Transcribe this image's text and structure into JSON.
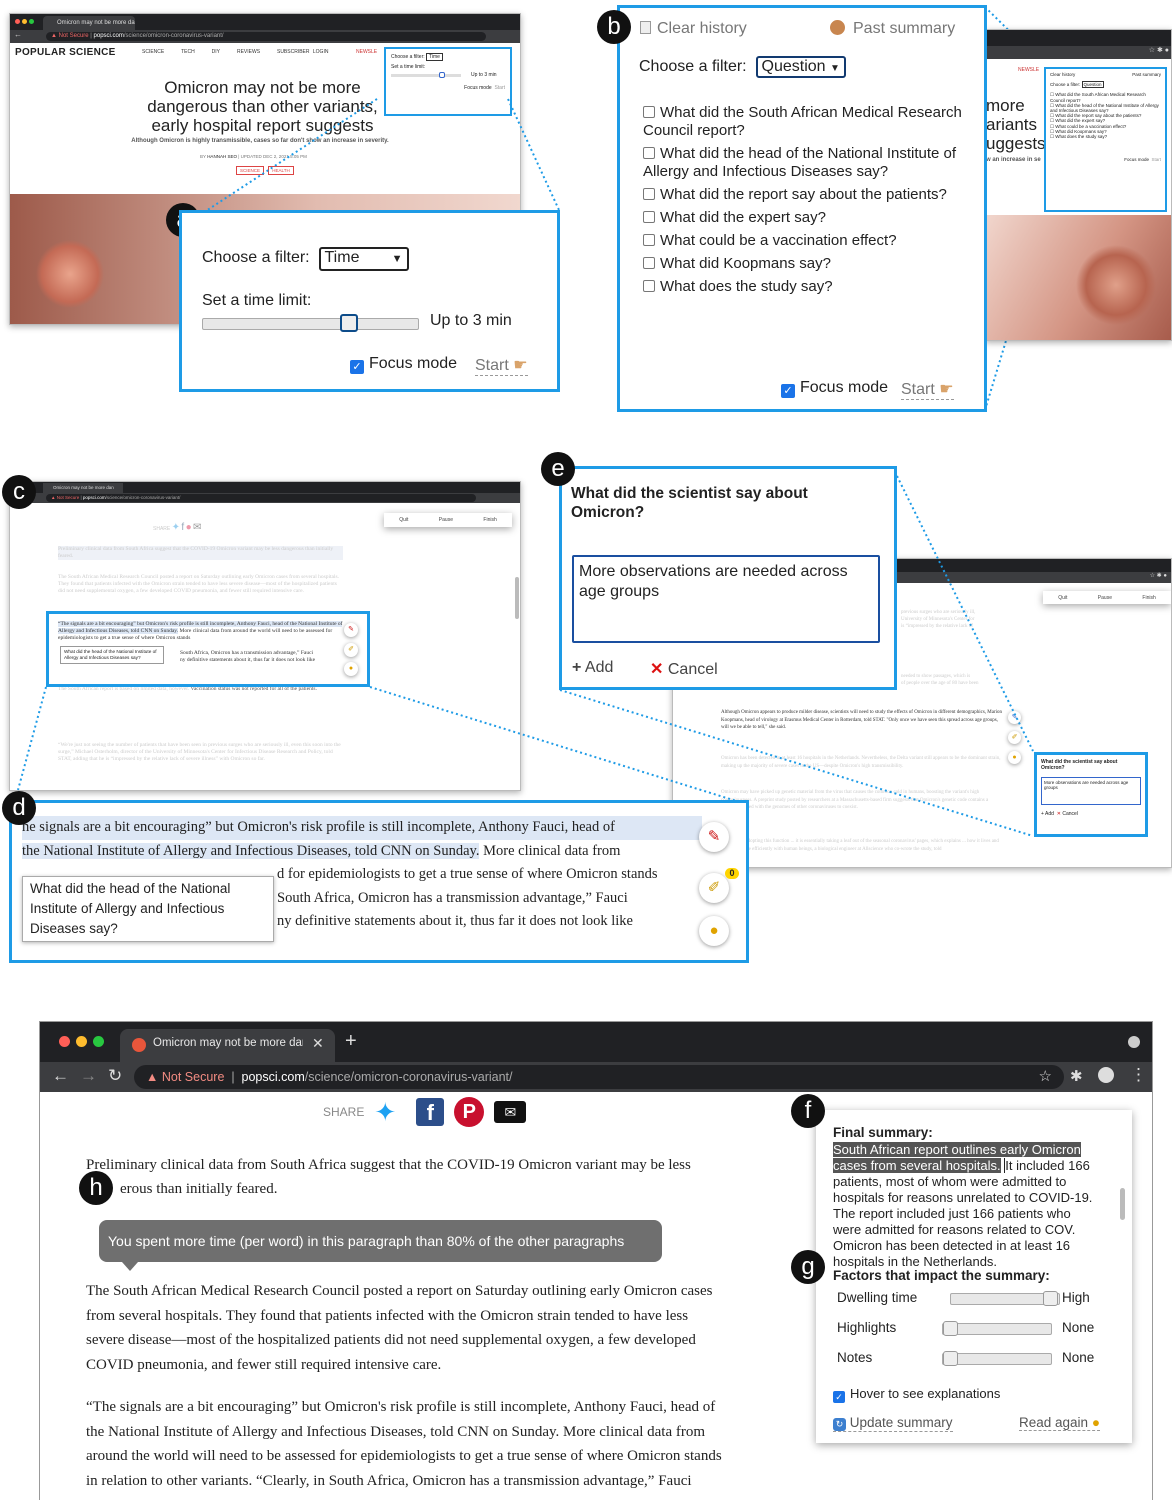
{
  "labels": {
    "a": "a",
    "b": "b",
    "c": "c",
    "d": "d",
    "e": "e",
    "f": "f",
    "g": "g",
    "h": "h"
  },
  "browser": {
    "tab_title": "Omicron may not be more dang",
    "address_warning": "Not Secure",
    "url_host": "popsci.com",
    "url_path": "/science/omicron-coronavirus-variant/",
    "small_tab": "Omicron may not be more dan",
    "small_url_host": "popsci.com",
    "small_url_path": "/science/omicron-coronavirus-variant/"
  },
  "popsci": {
    "logo": "POPULAR SCIENCE",
    "nav": [
      "SCIENCE",
      "TECH",
      "DIY",
      "REVIEWS",
      "SUBSCRIBER LOGIN"
    ],
    "newsletter": "NEWSLE",
    "headline": "Omicron may not be more dangerous than other variants, early hospital report suggests",
    "subhead": "Although Omicron is highly transmissible, cases so far don't show an increase in severity.",
    "byline_by": "BY",
    "byline_author": "HANNAH SEO",
    "byline_updated": "| UPDATED DEC 2, 2021 5:05 PM",
    "tags": [
      "SCIENCE",
      "HEALTH"
    ]
  },
  "panel_a": {
    "filter_label": "Choose a filter:",
    "filter_value": "Time",
    "time_label": "Set a time limit:",
    "time_value": "Up to 3 min",
    "focus_label": "Focus mode",
    "start_label": "Start",
    "slider_fraction": 0.7,
    "mini_filter_label": "Choose a filter:",
    "mini_filter_value": "Time",
    "mini_time_label": "Set a time limit:",
    "mini_time_value": "Up to 3 min",
    "mini_focus": "Focus mode",
    "mini_start": "Start"
  },
  "panel_b": {
    "clear_history": "Clear history",
    "past_summary": "Past summary",
    "filter_label": "Choose a filter:",
    "filter_value": "Question",
    "questions": [
      "What did the South African Medical Research Council report?",
      "What did the head of the National Institute of Allergy and Infectious Diseases say?",
      "What did the report say about the patients?",
      "What did the expert say?",
      "What could be a vaccination effect?",
      "What did Koopmans say?",
      "What does the study say?"
    ],
    "focus_label": "Focus mode",
    "start_label": "Start",
    "bg_headline": [
      "more",
      "ariants",
      "uggests"
    ],
    "bg_tail": "w an increase in se",
    "bg_newsletter": "NEWSLE",
    "mini_clear": "Clear history",
    "mini_past": "Past summary",
    "mini_filter_label": "Choose a filter:",
    "mini_filter_value": "Question",
    "mini_questions": [
      "What did the South African Medical Research Council report?",
      "What did the head of the National Institute of Allergy and Infectious Diseases say?",
      "What did the report say about the patients?",
      "What did the expert say?",
      "What could be a vaccination effect?",
      "What did Koopmans say?",
      "What does the study say?"
    ],
    "mini_focus": "Focus mode",
    "mini_start": "Start"
  },
  "panel_c": {
    "share": "SHARE",
    "toolbar": [
      "Quit",
      "Pause",
      "Finish"
    ],
    "para1": "Preliminary clinical data from South Africa suggest that the COVID-19 Omicron variant may be less dangerous than initially feared.",
    "para2": "The South African Medical Research Council posted a report on Saturday outlining early Omicron cases from several hospitals. They found that patients infected with the Omicron strain tended to have less severe disease—most of the hospitalized patients did not need supplemental oxygen, a few developed COVID pneumonia, and fewer still required intensive care.",
    "para3_hl": "“The signals are a bit encouraging” but Omicron's risk profile is still incomplete, Anthony Fauci, head of the National Institute of Allergy and Infectious Diseases, told CNN on Sunday.",
    "para3_rest_a": "More clinical data from",
    "para3_rest_b": "around the world will need to be assessed for epidemiologists to get a true sense of where Omicron stands",
    "para3_rest_c": "South Africa, Omicron has a transmission advantage,” Fauci",
    "para3_rest_d": "ny definitive statements about it, thus far it does not look like",
    "tooltip": "What did the head of the National Institute of Allergy and Infectious Diseases say?",
    "para4": "The South African report is based on limited data, however.",
    "para4b": "Vaccination status was not reported for all of the patients.",
    "para5": "“We're just not seeing the number of patients that have been seen in previous surges who are seriously ill, even this soon into the surge,” Michael Osterholm, director of the University of Minnesota's Center for Infectious Disease Research and Policy, told STAT, adding that he is “impressed by the relative lack of severe illness” with Omicron so far."
  },
  "panel_d": {
    "line1": "he signals are a bit encouraging” but Omicron's risk profile is still incomplete, Anthony Fauci, head of",
    "line2_hl": "the National Institute of Allergy and Infectious Diseases, told CNN on Sunday.",
    "line2_rest": "More clinical data from",
    "line3": "d for epidemiologists to get a true sense of where Omicron stands",
    "line4": "South Africa, Omicron has a transmission advantage,” Fauci",
    "line5": "ny definitive statements about it, thus far it does not look like",
    "tooltip": "What did the head of the National Institute of Allergy and Infectious Diseases say?",
    "badge": "0"
  },
  "panel_e": {
    "question": "What did the scientist say about Omicron?",
    "answer": "More observations are needed across age groups",
    "add": "Add",
    "cancel": "Cancel",
    "toolbar": [
      "Quit",
      "Pause",
      "Finish"
    ],
    "bg1": "previous surges who are seriously ill,",
    "bg2": "University of Minnesota's Center for",
    "bg3": "is “impressed by the relative lack of",
    "bg4": "needed to show passages, which is",
    "bg5": "of people over the age of 80 have been",
    "bg6": "Although Omicron appears to produce milder disease, scientists will need to study the effects of Omicron in different demographics, Marion Koopmans, head of virology at Erasmus Medical Center in Rotterdam, told STAT. \"Only once we have seen this spread across age groups, will we be able to tell,\" she said.",
    "bg7": "Omicron has been detected in at least 16 hospitals in the Netherlands. Nevertheless, the Delta variant still appears to be the dominant strain, making up the majority of severe cases in the US—despite Omicron's high transmissibility.",
    "bg8": "Omicron may have picked up genetic material from the virus that causes the common cold in humans, boosting the variant's high contagiousness. A preprint study posted by researchers at a Massachusetts-based firm suggests that Omicron's genetic code contains a sequence shared with the genomes of other coronaviruses to coexist.",
    "bg9": "of Omicron adopting this function ... it is essentially taking a leaf out of the seasonal coronavirus' pages, which explains ... how it lives and transmits more efficiently with human beings,",
    "bg10": "a biological engineer at Allscience who co-wrote the study, told",
    "mini_question": "What did the scientist say about Omicron?",
    "mini_answer": "More observations are needed across age groups",
    "mini_add": "Add",
    "mini_cancel": "Cancel"
  },
  "bottom": {
    "share": "SHARE",
    "para1a": "Preliminary clinical data from South Africa suggest that the COVID-19 Omicron variant may be less",
    "para1b": "erous than initially feared.",
    "tooltip": "You spent more time (per word) in this paragraph than 80% of the other paragraphs",
    "para2": [
      "The South African Medical Research Council posted a report on Saturday outlining early Omicron cases",
      "from several hospitals. They found that patients infected with the Omicron strain tended to have less",
      "severe disease—most of the hospitalized patients did not need supplemental oxygen, a few developed",
      "COVID pneumonia, and fewer still required intensive care."
    ],
    "para3": [
      "“The signals are a bit encouraging” but Omicron's risk profile is still incomplete, Anthony Fauci, head of",
      "the National Institute of Allergy and Infectious Diseases, told CNN on Sunday. More clinical data from",
      "around the world will need to be assessed for epidemiologists to get a true sense of where Omicron stands",
      "in relation to other variants. “Clearly, in South Africa, Omicron has a transmission advantage,” Fauci"
    ]
  },
  "summary": {
    "title": "Final summary:",
    "sel1": "South African report outlines early Omicron",
    "sel2": "cases from several hospitals.",
    "rest2": "It included 166",
    "lines": [
      "patients, most of whom were admitted to",
      "hospitals for reasons unrelated to COVID-19.",
      "The report included just 166 patients who",
      "were admitted for reasons related to COV.",
      "Omicron has been detected in at least 16",
      "hospitals in the Netherlands."
    ],
    "factors_title": "Factors that impact the summary:",
    "factors": [
      {
        "name": "Dwelling time",
        "value": "High",
        "level": 1.0
      },
      {
        "name": "Highlights",
        "value": "None",
        "level": 0.0
      },
      {
        "name": "Notes",
        "value": "None",
        "level": 0.0
      }
    ],
    "hover": "Hover to see explanations",
    "update": "Update summary",
    "read_again": "Read again"
  }
}
